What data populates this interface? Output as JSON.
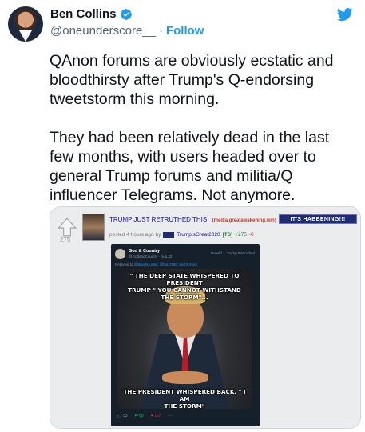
{
  "author": {
    "display_name": "Ben Collins",
    "handle": "@oneunderscore__",
    "separator": "·",
    "follow_label": "Follow"
  },
  "tweet": {
    "text": "QAnon forums are obviously ecstatic and bloodthirsty after Trump's Q-endorsing tweetstorm this morning.\n\nThey had been relatively dead in the last few months, with users headed over to general Trump forums and militia/Q influencer Telegrams. Not anymore."
  },
  "forum_post": {
    "score": "275",
    "title": "TRUMP JUST RETRUTHED THIS!",
    "domain": "(media.greatawakening.win)",
    "flair": "IT'S HABBENING!!!",
    "posted": "posted 4 hours ago by",
    "username": "TrumpIsGreat2020",
    "user_tag": "[TS]",
    "upvotes": "+275",
    "downvotes": "-0"
  },
  "embedded_post": {
    "name": "God & Country",
    "handle": "@GodandCountry · Aug 22",
    "retruthed": "Donald J. Trump ReTruthed",
    "replying_prefix": "Replying to",
    "replying_users": "@BryanHunter, @bunz109, and 8 more",
    "meme_top": "\" THE DEEP STATE WHISPERED TO PRESIDENT\nTRUMP \" YOU CANNOT WITHSTAND THE STORM\"...",
    "meme_bottom": "THE PRESIDENT WHISPERED BACK, \" I AM\nTHE STORM\"",
    "replies": "53",
    "retruths": "69",
    "likes": "187",
    "more": "···"
  },
  "colors": {
    "follow": "#1d9bf0",
    "dark_card": "#15202b",
    "flair": "#1f2b72"
  },
  "icons": [
    "verified-badge-icon",
    "twitter-bird-icon",
    "upvote-arrow-icon"
  ]
}
